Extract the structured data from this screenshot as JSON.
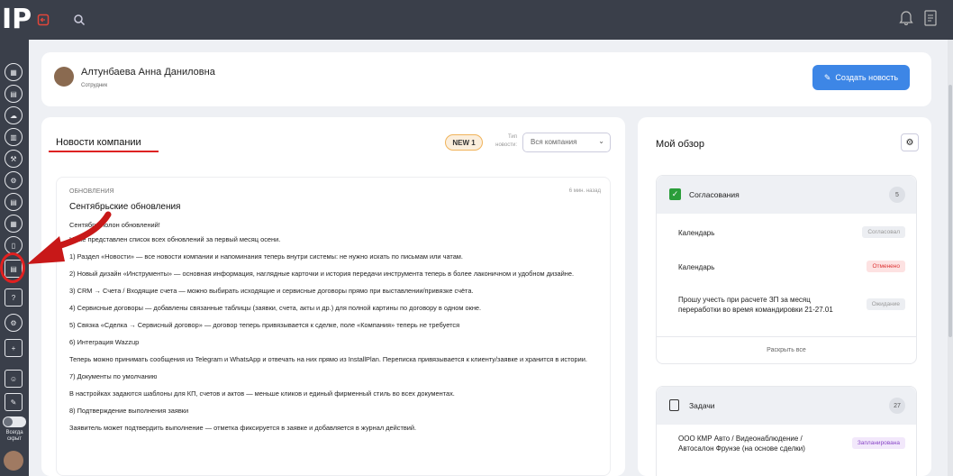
{
  "header": {
    "logo": "IP"
  },
  "sidebar": {
    "toggle_label": "Всегда скрыт"
  },
  "user": {
    "name": "Алтунбаева Анна Даниловна",
    "role": "Сотрудник",
    "create_button": "Создать новость"
  },
  "news": {
    "title": "Новости компании",
    "new_badge": "NEW 1",
    "type_label": "Тип новости:",
    "type_value": "Вся компания",
    "post": {
      "category": "ОБНОВЛЕНИЯ",
      "time": "6 мин. назад",
      "title": "Сентябрьские обновления",
      "paragraphs": [
        "Сентябрь полон обновлений!",
        "Ниже представлен список всех обновлений за первый месяц осени.",
        "1) Раздел «Новости» — все новости компании и напоминания теперь внутри системы: не нужно искать по письмам или чатам.",
        "2) Новый дизайн «Инструменты» — основная информация, наглядные карточки и история передачи инструмента теперь в более лаконичном и удобном дизайне.",
        "3) CRM → Счета / Входящие счета — можно выбирать исходящие и сервисные договоры прямо при выставлении/привязке счёта.",
        "4) Сервисные договоры — добавлены связанные таблицы (заявки, счета, акты и др.) для полной картины по договору в одном окне.",
        "5) Связка «Сделка → Сервисный договор» — договор теперь привязывается к сделке, поле «Компания» теперь не требуется",
        "6) Интеграция Wazzup",
        "Теперь можно принимать сообщения из Telegram и WhatsApp и отвечать на них прямо из InstallPlan. Переписка привязывается к клиенту/заявке и хранится в истории.",
        "7) Документы по умолчанию",
        "В настройках задаются шаблоны для КП, счетов и актов — меньше кликов и единый фирменный стиль во всех документах.",
        "8) Подтверждение выполнения заявки",
        "Заявитель может подтвердить выполнение — отметка фиксируется в заявке и добавляется в журнал действий."
      ]
    }
  },
  "overview": {
    "title": "Мой обзор",
    "approvals": {
      "title": "Согласования",
      "count": "5",
      "rows": [
        {
          "label": "Календарь",
          "status": "Согласовал"
        },
        {
          "label": "Календарь",
          "status": "Отменено"
        },
        {
          "label": "Прошу учесть при расчете ЗП за месяц переработки во время командировки 21-27.01",
          "status": "Ожидание"
        }
      ],
      "expand": "Раскрыть все"
    },
    "tasks": {
      "title": "Задачи",
      "count": "27",
      "rows": [
        {
          "label": "ООО КМР Авто / Видеонаблюдение / Автосалон Фрунзе (на основе сделки)",
          "status": "Запланирована"
        }
      ]
    }
  },
  "colors": {
    "topbar": "#3a3f4a",
    "accent": "#3d86e6",
    "highlight": "#e02020"
  }
}
